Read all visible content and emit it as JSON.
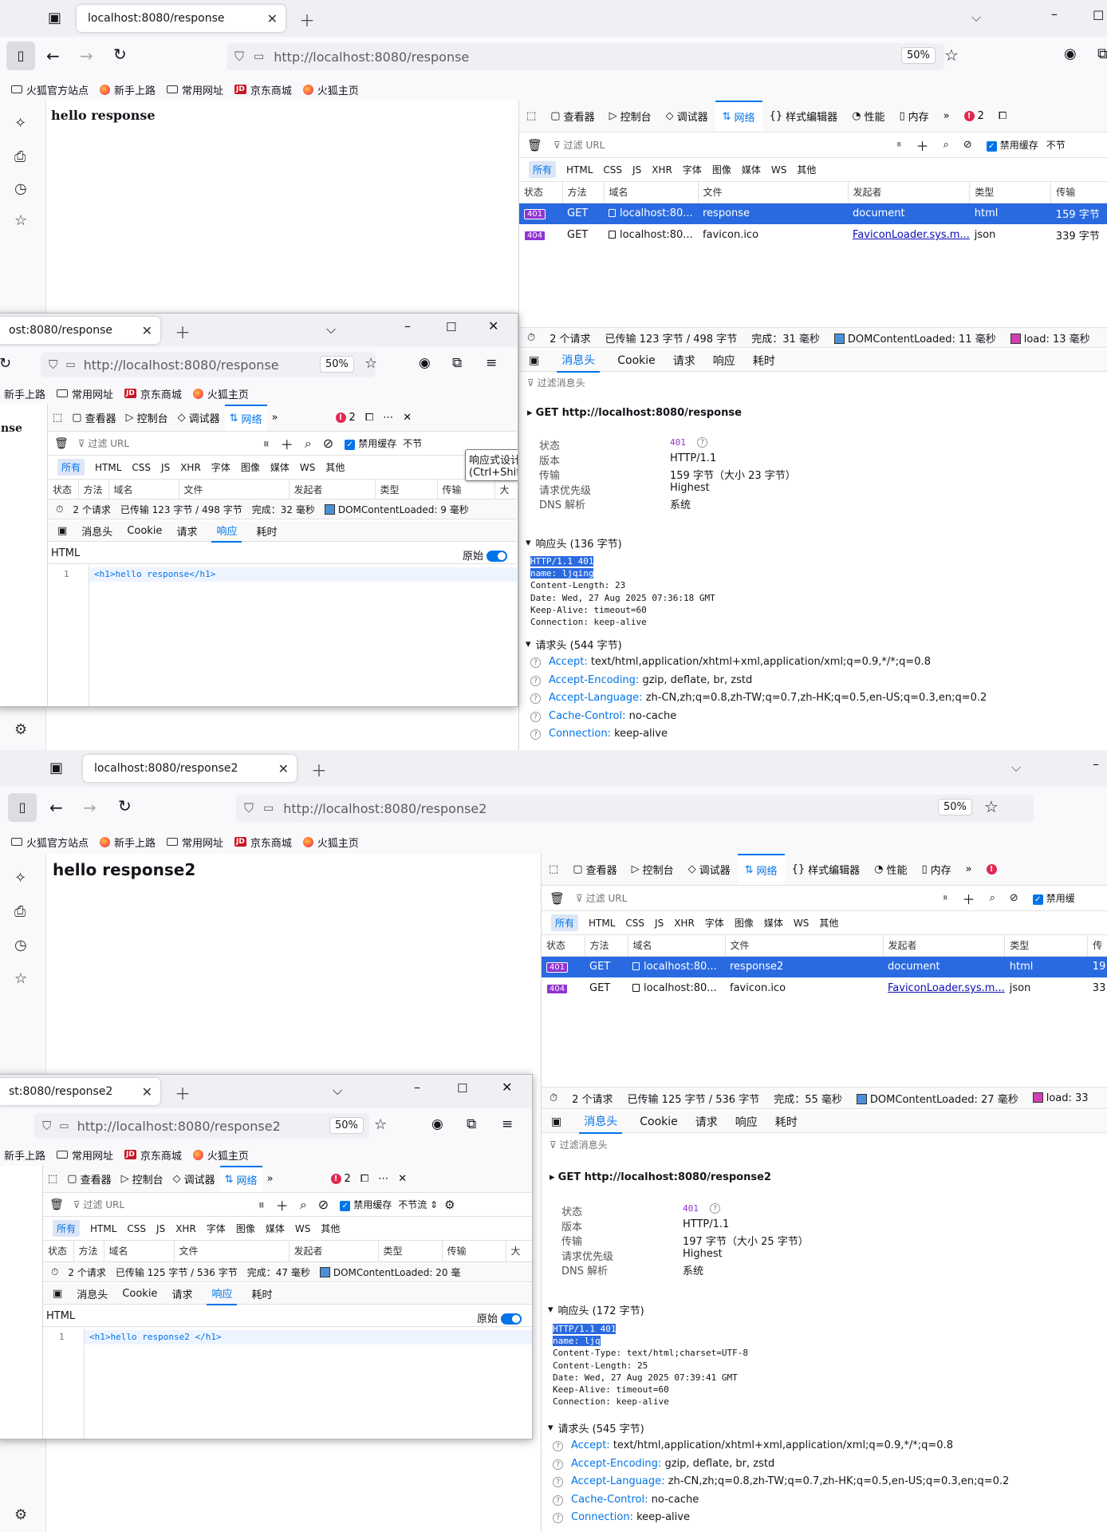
{
  "shots": [
    {
      "tab_title": "localhost:8080/response",
      "url": "http://localhost:8080/response",
      "zoom": "50%",
      "heading": "hello response",
      "bookmarks": [
        "火狐官方站点",
        "新手上路",
        "常用网址",
        "京东商城",
        "火狐主页"
      ],
      "devtools_tabs": [
        "查看器",
        "控制台",
        "调试器",
        "网络",
        "样式编辑器",
        "性能",
        "内存"
      ],
      "error_count": "2",
      "filter_placeholder": "过滤 URL",
      "disable_cache": "禁用缓存",
      "throttle": "不节",
      "types": [
        "所有",
        "HTML",
        "CSS",
        "JS",
        "XHR",
        "字体",
        "图像",
        "媒体",
        "WS",
        "其他"
      ],
      "columns": [
        "状态",
        "方法",
        "域名",
        "文件",
        "发起者",
        "类型",
        "传输"
      ],
      "requests": [
        {
          "status": "401",
          "method": "GET",
          "domain": "localhost:80...",
          "file": "response",
          "initiator": "document",
          "type": "html",
          "transfer": "159 字节"
        },
        {
          "status": "404",
          "method": "GET",
          "domain": "localhost:80...",
          "file": "favicon.ico",
          "initiator": "FaviconLoader.sys.m...",
          "type": "json",
          "transfer": "339 字节"
        }
      ],
      "summary": {
        "count": "2 个请求",
        "transferred": "已传输 123 字节 / 498 字节",
        "finish": "完成：31 毫秒",
        "dcl": "DOMContentLoaded: 11 毫秒",
        "load": "load: 13 毫秒"
      },
      "panel_tabs": [
        "消息头",
        "Cookie",
        "请求",
        "响应",
        "耗时"
      ],
      "filter_headers": "过滤消息头",
      "request_line": "GET  http://localhost:8080/response",
      "details": [
        {
          "k": "状态",
          "v": "401"
        },
        {
          "k": "版本",
          "v": "HTTP/1.1"
        },
        {
          "k": "传输",
          "v": "159 字节（大小 23 字节）"
        },
        {
          "k": "请求优先级",
          "v": "Highest"
        },
        {
          "k": "DNS 解析",
          "v": "系统"
        }
      ],
      "resp_header_title": "响应头 (136 字节)",
      "raw_highlight": [
        "HTTP/1.1 401",
        "name: ljqing"
      ],
      "raw_rest": [
        "Content-Length: 23",
        "Date: Wed, 27 Aug 2025 07:36:18 GMT",
        "Keep-Alive: timeout=60",
        "Connection: keep-alive"
      ],
      "req_header_title": "请求头 (544 字节)",
      "req_headers": [
        {
          "k": "Accept:",
          "v": "text/html,application/xhtml+xml,application/xml;q=0.9,*/*;q=0.8"
        },
        {
          "k": "Accept-Encoding:",
          "v": "gzip, deflate, br, zstd"
        },
        {
          "k": "Accept-Language:",
          "v": "zh-CN,zh;q=0.8,zh-TW;q=0.7,zh-HK;q=0.5,en-US;q=0.3,en;q=0.2"
        },
        {
          "k": "Cache-Control:",
          "v": "no-cache"
        },
        {
          "k": "Connection:",
          "v": "keep-alive"
        }
      ],
      "inner": {
        "tab_title": "ost:8080/response",
        "url": "http://localhost:8080/response",
        "zoom": "50%",
        "bookmarks": [
          "新手上路",
          "常用网址",
          "京东商城",
          "火狐主页"
        ],
        "page_text": "nse",
        "devtools_tabs": [
          "查看器",
          "控制台",
          "调试器",
          "网络"
        ],
        "error_count": "2",
        "filter_placeholder": "过滤 URL",
        "disable_cache": "禁用缓存",
        "throttle": "不节",
        "types": [
          "所有",
          "HTML",
          "CSS",
          "JS",
          "XHR",
          "字体",
          "图像",
          "媒体",
          "WS",
          "其他"
        ],
        "columns": [
          "状态",
          "方法",
          "域名",
          "文件",
          "发起者",
          "类型",
          "传输",
          "大"
        ],
        "summary": {
          "count": "2 个请求",
          "transferred": "已传输 123 字节 / 498 字节",
          "finish": "完成：32 毫秒",
          "dcl": "DOMContentLoaded: 9 毫秒"
        },
        "panel_tabs": [
          "消息头",
          "Cookie",
          "请求",
          "响应",
          "耗时"
        ],
        "html_label": "HTML",
        "raw_label": "原始",
        "code_line_no": "1",
        "code": "<h1>hello response</h1>",
        "tooltip": "响应式设计模式 (Ctrl+Shift+M)"
      }
    },
    {
      "tab_title": "localhost:8080/response2",
      "url": "http://localhost:8080/response2",
      "zoom": "50%",
      "heading": "hello response2",
      "bookmarks": [
        "火狐官方站点",
        "新手上路",
        "常用网址",
        "京东商城",
        "火狐主页"
      ],
      "devtools_tabs": [
        "查看器",
        "控制台",
        "调试器",
        "网络",
        "样式编辑器",
        "性能",
        "内存"
      ],
      "filter_placeholder": "过滤 URL",
      "disable_cache": "禁用缓",
      "types": [
        "所有",
        "HTML",
        "CSS",
        "JS",
        "XHR",
        "字体",
        "图像",
        "媒体",
        "WS",
        "其他"
      ],
      "columns": [
        "状态",
        "方法",
        "域名",
        "文件",
        "发起者",
        "类型",
        "传"
      ],
      "requests": [
        {
          "status": "401",
          "method": "GET",
          "domain": "localhost:80...",
          "file": "response2",
          "initiator": "document",
          "type": "html",
          "transfer": "19"
        },
        {
          "status": "404",
          "method": "GET",
          "domain": "localhost:80...",
          "file": "favicon.ico",
          "initiator": "FaviconLoader.sys.m...",
          "type": "json",
          "transfer": "33"
        }
      ],
      "summary": {
        "count": "2 个请求",
        "transferred": "已传输 125 字节 / 536 字节",
        "finish": "完成：55 毫秒",
        "dcl": "DOMContentLoaded: 27 毫秒",
        "load": "load: 33"
      },
      "panel_tabs": [
        "消息头",
        "Cookie",
        "请求",
        "响应",
        "耗时"
      ],
      "filter_headers": "过滤消息头",
      "request_line": "GET  http://localhost:8080/response2",
      "details": [
        {
          "k": "状态",
          "v": "401"
        },
        {
          "k": "版本",
          "v": "HTTP/1.1"
        },
        {
          "k": "传输",
          "v": "197 字节（大小 25 字节）"
        },
        {
          "k": "请求优先级",
          "v": "Highest"
        },
        {
          "k": "DNS 解析",
          "v": "系统"
        }
      ],
      "resp_header_title": "响应头 (172 字节)",
      "raw_highlight": [
        "HTTP/1.1 401",
        "name: ljq"
      ],
      "raw_rest": [
        "Content-Type: text/html;charset=UTF-8",
        "Content-Length: 25",
        "Date: Wed, 27 Aug 2025 07:39:41 GMT",
        "Keep-Alive: timeout=60",
        "Connection: keep-alive"
      ],
      "req_header_title": "请求头 (545 字节)",
      "req_headers": [
        {
          "k": "Accept:",
          "v": "text/html,application/xhtml+xml,application/xml;q=0.9,*/*;q=0.8"
        },
        {
          "k": "Accept-Encoding:",
          "v": "gzip, deflate, br, zstd"
        },
        {
          "k": "Accept-Language:",
          "v": "zh-CN,zh;q=0.8,zh-TW;q=0.7,zh-HK;q=0.5,en-US;q=0.3,en;q=0.2"
        },
        {
          "k": "Cache-Control:",
          "v": "no-cache"
        },
        {
          "k": "Connection:",
          "v": "keep-alive"
        }
      ],
      "inner": {
        "tab_title": "st:8080/response2",
        "url": "http://localhost:8080/response2",
        "zoom": "50%",
        "bookmarks": [
          "新手上路",
          "常用网址",
          "京东商城",
          "火狐主页"
        ],
        "devtools_tabs": [
          "查看器",
          "控制台",
          "调试器",
          "网络"
        ],
        "error_count": "2",
        "filter_placeholder": "过滤 URL",
        "disable_cache": "禁用缓存",
        "throttle": "不节流",
        "types": [
          "所有",
          "HTML",
          "CSS",
          "JS",
          "XHR",
          "字体",
          "图像",
          "媒体",
          "WS",
          "其他"
        ],
        "columns": [
          "状态",
          "方法",
          "域名",
          "文件",
          "发起者",
          "类型",
          "传输",
          "大"
        ],
        "summary": {
          "count": "2 个请求",
          "transferred": "已传输 125 字节 / 536 字节",
          "finish": "完成：47 毫秒",
          "dcl": "DOMContentLoaded: 20 毫"
        },
        "panel_tabs": [
          "消息头",
          "Cookie",
          "请求",
          "响应",
          "耗时"
        ],
        "html_label": "HTML",
        "raw_label": "原始",
        "code_line_no": "1",
        "code": "<h1>hello response2 </h1>"
      }
    }
  ]
}
